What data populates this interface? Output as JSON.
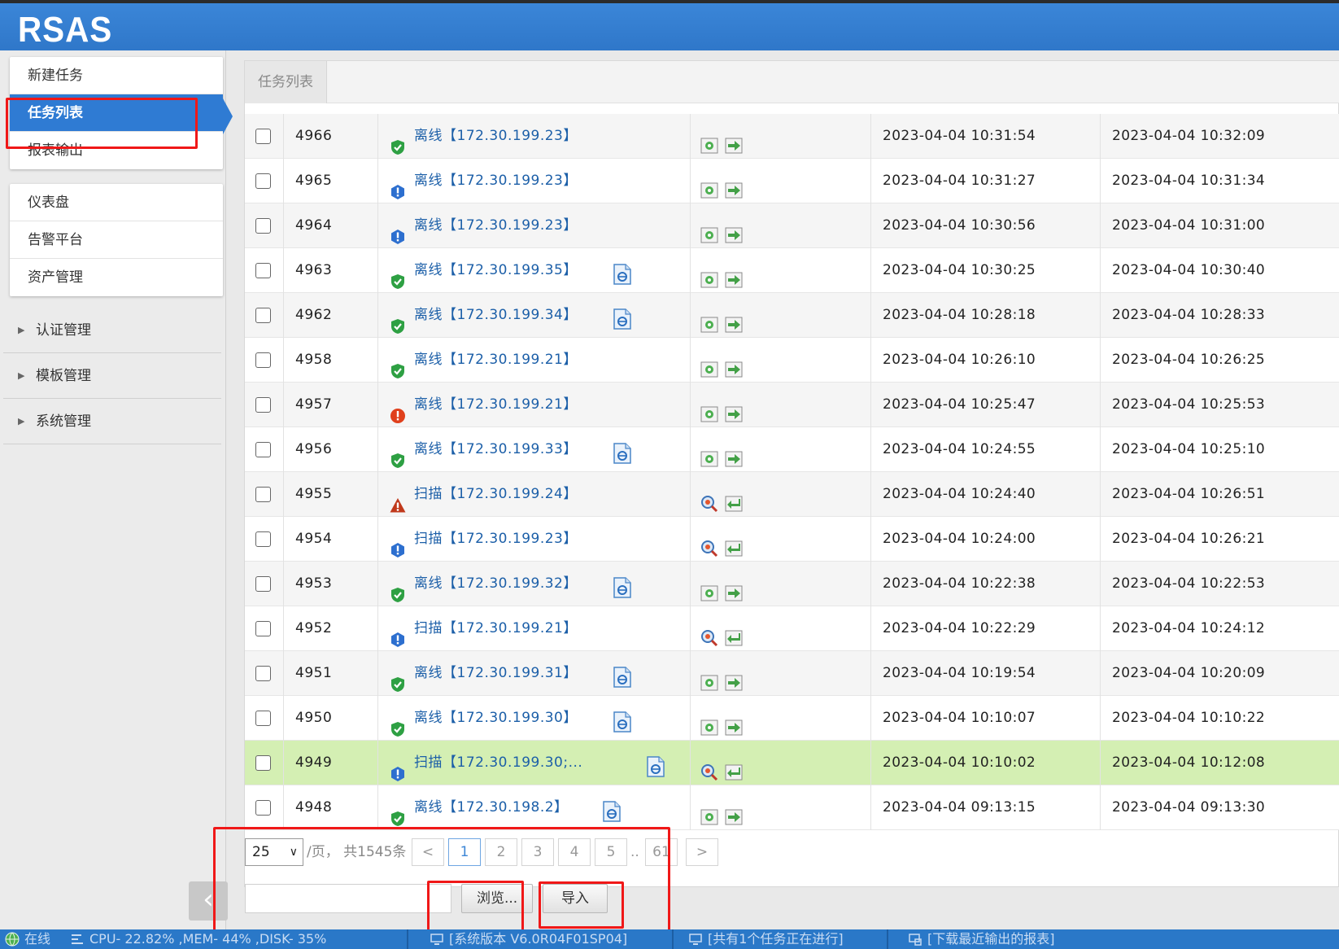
{
  "app": {
    "logo": "RSAS"
  },
  "sidebar": {
    "card1": [
      "新建任务",
      "任务列表",
      "报表输出"
    ],
    "card2": [
      "仪表盘",
      "告警平台",
      "资产管理"
    ],
    "groups": [
      "认证管理",
      "模板管理",
      "系统管理"
    ],
    "collapse_glyph": "‹"
  },
  "tabs": {
    "active": "任务列表"
  },
  "tasks": [
    {
      "id": "4966",
      "status": "ok",
      "type": "离线",
      "target": "【172.30.199.23】",
      "report": false,
      "mode": "offline",
      "start": "2023-04-04 10:31:54",
      "end": "2023-04-04 10:32:09"
    },
    {
      "id": "4965",
      "status": "info",
      "type": "离线",
      "target": "【172.30.199.23】",
      "report": false,
      "mode": "offline",
      "start": "2023-04-04 10:31:27",
      "end": "2023-04-04 10:31:34"
    },
    {
      "id": "4964",
      "status": "info",
      "type": "离线",
      "target": "【172.30.199.23】",
      "report": false,
      "mode": "offline",
      "start": "2023-04-04 10:30:56",
      "end": "2023-04-04 10:31:00"
    },
    {
      "id": "4963",
      "status": "ok",
      "type": "离线",
      "target": "【172.30.199.35】",
      "report": true,
      "mode": "offline",
      "start": "2023-04-04 10:30:25",
      "end": "2023-04-04 10:30:40"
    },
    {
      "id": "4962",
      "status": "ok",
      "type": "离线",
      "target": "【172.30.199.34】",
      "report": true,
      "mode": "offline",
      "start": "2023-04-04 10:28:18",
      "end": "2023-04-04 10:28:33"
    },
    {
      "id": "4958",
      "status": "ok",
      "type": "离线",
      "target": "【172.30.199.21】",
      "report": false,
      "mode": "offline",
      "start": "2023-04-04 10:26:10",
      "end": "2023-04-04 10:26:25"
    },
    {
      "id": "4957",
      "status": "err",
      "type": "离线",
      "target": "【172.30.199.21】",
      "report": false,
      "mode": "offline",
      "start": "2023-04-04 10:25:47",
      "end": "2023-04-04 10:25:53"
    },
    {
      "id": "4956",
      "status": "ok",
      "type": "离线",
      "target": "【172.30.199.33】",
      "report": true,
      "mode": "offline",
      "start": "2023-04-04 10:24:55",
      "end": "2023-04-04 10:25:10"
    },
    {
      "id": "4955",
      "status": "warn",
      "type": "扫描",
      "target": "【172.30.199.24】",
      "report": false,
      "mode": "scan",
      "start": "2023-04-04 10:24:40",
      "end": "2023-04-04 10:26:51"
    },
    {
      "id": "4954",
      "status": "info",
      "type": "扫描",
      "target": "【172.30.199.23】",
      "report": false,
      "mode": "scan",
      "start": "2023-04-04 10:24:00",
      "end": "2023-04-04 10:26:21"
    },
    {
      "id": "4953",
      "status": "ok",
      "type": "离线",
      "target": "【172.30.199.32】",
      "report": true,
      "mode": "offline",
      "start": "2023-04-04 10:22:38",
      "end": "2023-04-04 10:22:53"
    },
    {
      "id": "4952",
      "status": "info",
      "type": "扫描",
      "target": "【172.30.199.21】",
      "report": false,
      "mode": "scan",
      "start": "2023-04-04 10:22:29",
      "end": "2023-04-04 10:24:12"
    },
    {
      "id": "4951",
      "status": "ok",
      "type": "离线",
      "target": "【172.30.199.31】",
      "report": true,
      "mode": "offline",
      "start": "2023-04-04 10:19:54",
      "end": "2023-04-04 10:20:09"
    },
    {
      "id": "4950",
      "status": "ok",
      "type": "离线",
      "target": "【172.30.199.30】",
      "report": true,
      "mode": "offline",
      "start": "2023-04-04 10:10:07",
      "end": "2023-04-04 10:10:22"
    },
    {
      "id": "4949",
      "status": "info",
      "type": "扫描",
      "target": "【172.30.199.30;...",
      "report": true,
      "mode": "scan",
      "start": "2023-04-04 10:10:02",
      "end": "2023-04-04 10:12:08",
      "highlight": true
    },
    {
      "id": "4948",
      "status": "ok",
      "type": "离线",
      "target": "【172.30.198.2】",
      "report": true,
      "mode": "offline",
      "start": "2023-04-04 09:13:15",
      "end": "2023-04-04 09:13:30"
    }
  ],
  "pager": {
    "page_size": "25",
    "summary": "/页， 共1545条",
    "prev": "<",
    "next": ">",
    "pages": [
      "1",
      "2",
      "3",
      "4",
      "5"
    ],
    "ellipsis": "..",
    "last": "61",
    "current": "1"
  },
  "import": {
    "browse_label": "浏览...",
    "import_label": "导入",
    "file_value": ""
  },
  "statusbar": {
    "online": "在线",
    "resources": "CPU- 22.82% ,MEM- 44% ,DISK- 35%",
    "version": "[系统版本 V6.0R04F01SP04]",
    "tasks": "[共有1个任务正在进行]",
    "download": "[下载最近输出的报表]"
  },
  "colors": {
    "header": "#2f77c9",
    "accent": "#2f7bd3",
    "highlight_row": "#d4efb3",
    "link": "#1c5fa8",
    "annotation": "#f01818"
  }
}
